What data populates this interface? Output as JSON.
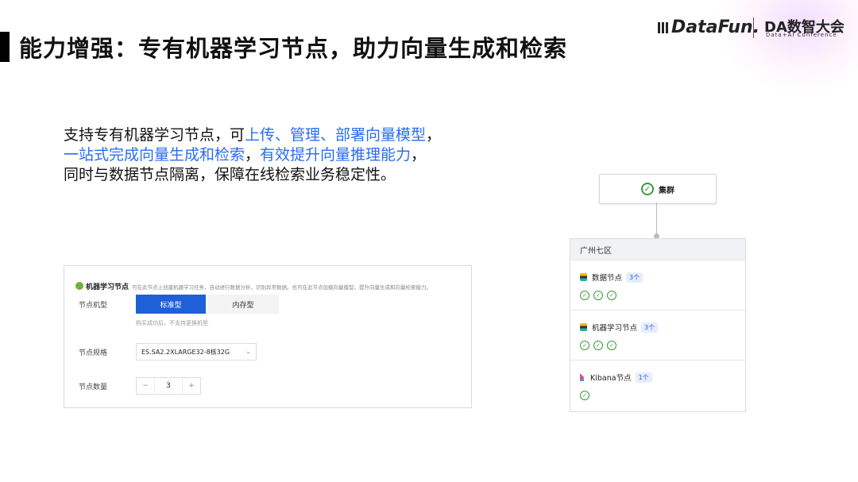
{
  "header": {
    "title": "能力增强：专有机器学习节点，助力向量生成和检索",
    "logo_datafun": "DataFun.",
    "logo_da": "DA数智大会",
    "logo_da_sub": "Data+AI Conference"
  },
  "description": {
    "line1_a": "支持专有机器学习节点，可",
    "line1_b": "上传、管理、部署向量模型",
    "line1_c": "，",
    "line2_a": "一站式完成向量生成和检索",
    "line2_b": "，",
    "line2_c": "有效提升向量推理能力",
    "line2_d": "，",
    "line3": "同时与数据节点隔离，保障在线检索业务稳定性。"
  },
  "form": {
    "panel_title": "机器学习节点",
    "panel_desc": "可在此节点上创建机器学习任务，自动进行数据分析，识别异常数据。也可在此节点加载向量模型，提升向量生成和向量检索能力。",
    "node_type_label": "节点机型",
    "node_type_options": [
      "标准型",
      "内存型"
    ],
    "node_type_hint": "购买成功后，不支持更换机型",
    "node_spec_label": "节点规格",
    "node_spec_value": "ES.SA2.2XLARGE32-8核32G",
    "node_count_label": "节点数量",
    "node_count_minus": "−",
    "node_count_value": "3",
    "node_count_plus": "+"
  },
  "diagram": {
    "cluster_label": "集群",
    "region_label": "广州七区",
    "nodes": [
      {
        "label": "数据节点",
        "count": "3个",
        "checks": 3
      },
      {
        "label": "机器学习节点",
        "count": "3个",
        "checks": 3
      },
      {
        "label": "Kibana节点",
        "count": "1个",
        "checks": 1
      }
    ]
  },
  "colors": {
    "accent_blue": "#2a6cf5",
    "button_blue": "#1f5fd8",
    "status_green": "#3a9a3a"
  }
}
